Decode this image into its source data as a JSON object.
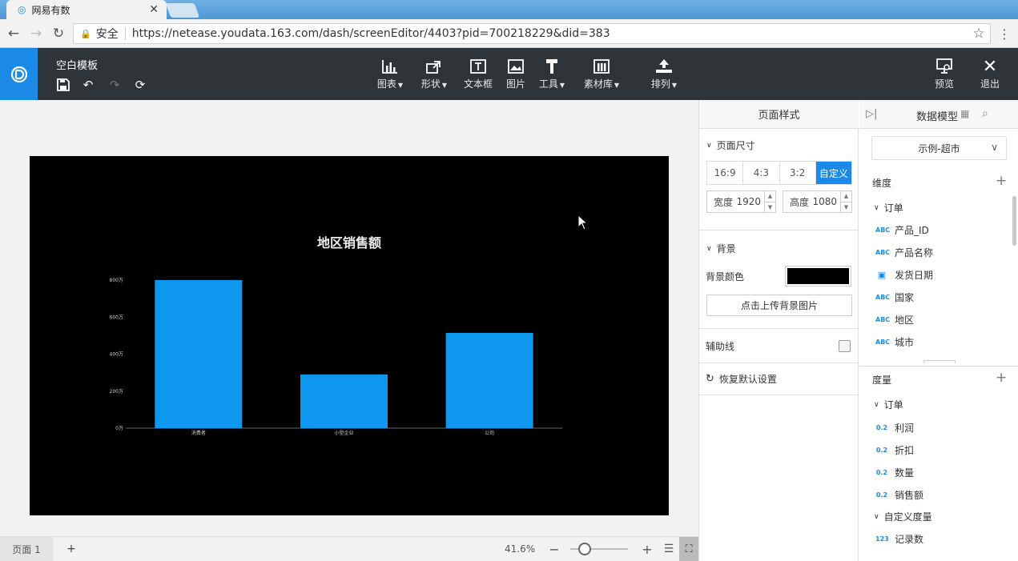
{
  "browser": {
    "tab_title": "网易有数",
    "security_label": "安全",
    "url": "https://netease.youdata.163.com/dash/screenEditor/4403?pid=700218229&did=383"
  },
  "app": {
    "template_name": "空白模板",
    "toolbar": [
      {
        "label": "图表",
        "icon": "bar-chart-icon",
        "dropdown": true
      },
      {
        "label": "形状",
        "icon": "shape-icon",
        "dropdown": true
      },
      {
        "label": "文本框",
        "icon": "textbox-icon",
        "dropdown": false
      },
      {
        "label": "图片",
        "icon": "image-icon",
        "dropdown": false
      },
      {
        "label": "工具",
        "icon": "tool-icon",
        "dropdown": true
      },
      {
        "label": "素材库",
        "icon": "material-icon",
        "dropdown": true
      },
      {
        "label": "排列",
        "icon": "arrange-icon",
        "dropdown": true
      }
    ],
    "preview_label": "预览",
    "exit_label": "退出"
  },
  "chart_data": {
    "type": "bar",
    "title": "地区销售额",
    "categories": [
      "消费者",
      "小型企业",
      "公司"
    ],
    "values": [
      800,
      290,
      515
    ],
    "yticks": [
      "0万",
      "200万",
      "400万",
      "600万",
      "800万"
    ],
    "ylim": [
      0,
      800
    ],
    "bar_color": "#0e97ee",
    "background": "#000000"
  },
  "bottom": {
    "page_tab": "页面 1",
    "add_page": "+",
    "zoom": "41.6%"
  },
  "style_panel": {
    "title": "页面样式",
    "page_size_label": "页面尺寸",
    "ratios": [
      "16:9",
      "4:3",
      "3:2",
      "自定义"
    ],
    "active_ratio": "自定义",
    "width_label": "宽度",
    "width_value": "1920",
    "height_label": "高度",
    "height_value": "1080",
    "background_label": "背景",
    "bg_color_label": "背景颜色",
    "bg_color": "#000000",
    "upload_label": "点击上传背景图片",
    "guides_label": "辅助线",
    "reset_label": "恢复默认设置"
  },
  "data_panel": {
    "title": "数据模型",
    "model_selected": "示例-超市",
    "dimension_label": "维度",
    "dimension_group": "订单",
    "dimensions": [
      {
        "type": "ABC",
        "name": "产品_ID"
      },
      {
        "type": "ABC",
        "name": "产品名称"
      },
      {
        "type": "date",
        "name": "发货日期"
      },
      {
        "type": "ABC",
        "name": "国家"
      },
      {
        "type": "ABC",
        "name": "地区"
      },
      {
        "type": "ABC",
        "name": "城市"
      }
    ],
    "measure_label": "度量",
    "measure_group": "订单",
    "measures": [
      {
        "type": "0.2",
        "name": "利润"
      },
      {
        "type": "0.2",
        "name": "折扣"
      },
      {
        "type": "0.2",
        "name": "数量"
      },
      {
        "type": "0.2",
        "name": "销售额"
      }
    ],
    "custom_measure_group": "自定义度量",
    "custom_measures": [
      {
        "type": "123",
        "name": "记录数"
      }
    ]
  }
}
